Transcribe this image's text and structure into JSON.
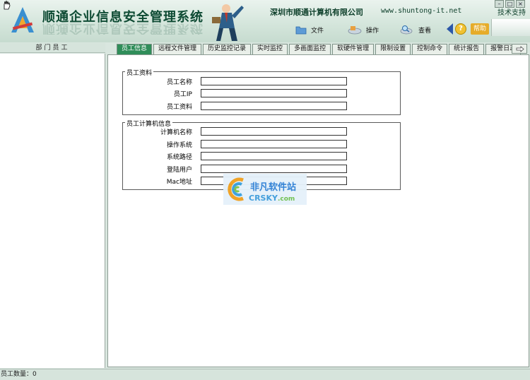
{
  "header": {
    "title": "顺通企业信息安全管理系统",
    "company": "深圳市顺通计算机有限公司",
    "website": "www.shuntong-it.net",
    "support": "技术支持",
    "menu": [
      {
        "label": "文件",
        "icon": "folder-icon"
      },
      {
        "label": "操作",
        "icon": "tools-icon"
      },
      {
        "label": "查看",
        "icon": "magnifier-icon"
      },
      {
        "label": "帮助",
        "icon": "help-icon"
      }
    ]
  },
  "sidebar": {
    "title": "部门员工"
  },
  "tabs": [
    "员工信息",
    "远程文件管理",
    "历史监控记录",
    "实时监控",
    "多画面监控",
    "软硬件管理",
    "限制设置",
    "控制命令",
    "统计报告",
    "报警日志"
  ],
  "active_tab": "员工信息",
  "employee_info": {
    "title": "员工资料",
    "fields": [
      {
        "label": "员工名称",
        "value": ""
      },
      {
        "label": "员工IP",
        "value": ""
      },
      {
        "label": "员工资料",
        "value": ""
      }
    ]
  },
  "computer_info": {
    "title": "员工计算机信息",
    "fields": [
      {
        "label": "计算机名称",
        "value": ""
      },
      {
        "label": "操作系统",
        "value": ""
      },
      {
        "label": "系统路径",
        "value": ""
      },
      {
        "label": "登陆用户",
        "value": ""
      },
      {
        "label": "Mac地址",
        "value": ""
      }
    ]
  },
  "watermark": {
    "cn": "非凡软件站",
    "en": "CRSKY",
    "domain": ".com"
  },
  "status": {
    "employee_count": "员工数量：0"
  },
  "colors": {
    "active_tab": "#2f8d59",
    "title": "#0d4a33",
    "background": "#d9e6df"
  }
}
